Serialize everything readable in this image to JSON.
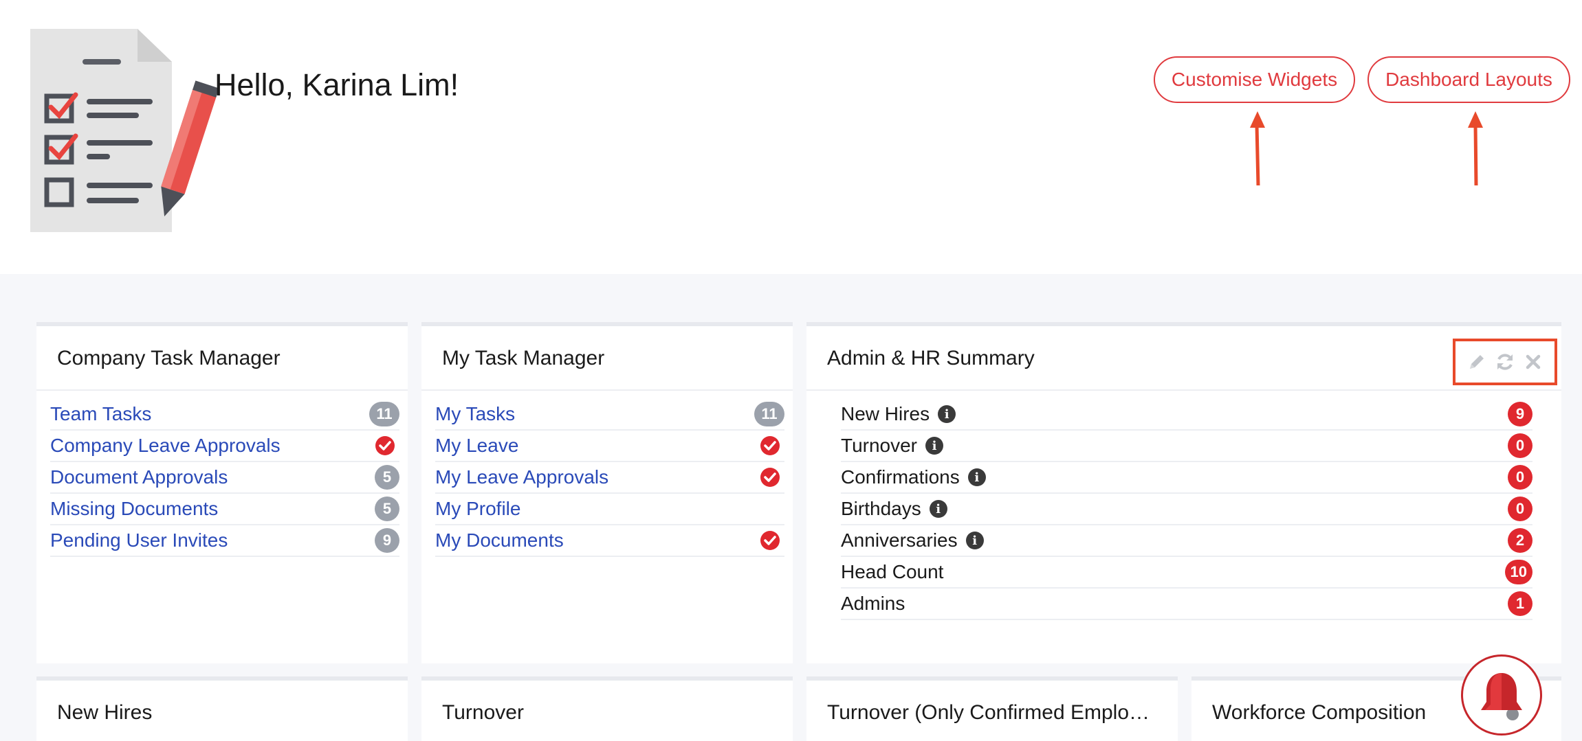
{
  "header": {
    "greeting": "Hello, Karina Lim!",
    "customise_label": "Customise Widgets",
    "layouts_label": "Dashboard Layouts"
  },
  "widgets": {
    "company_task_manager": {
      "title": "Company Task Manager",
      "rows": [
        {
          "label": "Team Tasks",
          "badge": "11",
          "status": "count"
        },
        {
          "label": "Company Leave Approvals",
          "badge": "",
          "status": "done"
        },
        {
          "label": "Document Approvals",
          "badge": "5",
          "status": "count"
        },
        {
          "label": "Missing Documents",
          "badge": "5",
          "status": "count"
        },
        {
          "label": "Pending User Invites",
          "badge": "9",
          "status": "count"
        }
      ]
    },
    "my_task_manager": {
      "title": "My Task Manager",
      "rows": [
        {
          "label": "My Tasks",
          "badge": "11",
          "status": "count"
        },
        {
          "label": "My Leave",
          "badge": "",
          "status": "done"
        },
        {
          "label": "My Leave Approvals",
          "badge": "",
          "status": "done"
        },
        {
          "label": "My Profile",
          "badge": "",
          "status": "none"
        },
        {
          "label": "My Documents",
          "badge": "",
          "status": "done"
        }
      ]
    },
    "admin_hr_summary": {
      "title": "Admin & HR Summary",
      "rows": [
        {
          "label": "New Hires",
          "value": "9",
          "info": true
        },
        {
          "label": "Turnover",
          "value": "0",
          "info": true
        },
        {
          "label": "Confirmations",
          "value": "0",
          "info": true
        },
        {
          "label": "Birthdays",
          "value": "0",
          "info": true
        },
        {
          "label": "Anniversaries",
          "value": "2",
          "info": true
        },
        {
          "label": "Head Count",
          "value": "10",
          "info": false
        },
        {
          "label": "Admins",
          "value": "1",
          "info": false
        }
      ],
      "tools": [
        "pencil-icon",
        "refresh-icon",
        "close-icon"
      ]
    },
    "bottom": {
      "new_hires_title": "New Hires",
      "turnover_title": "Turnover",
      "turnover_confirmed_title": "Turnover (Only Confirmed Emplo…",
      "workforce_title": "Workforce Composition"
    }
  },
  "colors": {
    "accent": "#e03a3e",
    "link": "#2a4ab8",
    "badge_gray": "#9ba1ab",
    "badge_red": "#e0282f",
    "annotation": "#e84a2b"
  },
  "icons": {
    "logo": "checklist-pencil-icon",
    "fab": "bell-icon",
    "check": "check-circle-icon",
    "info": "info-icon"
  }
}
